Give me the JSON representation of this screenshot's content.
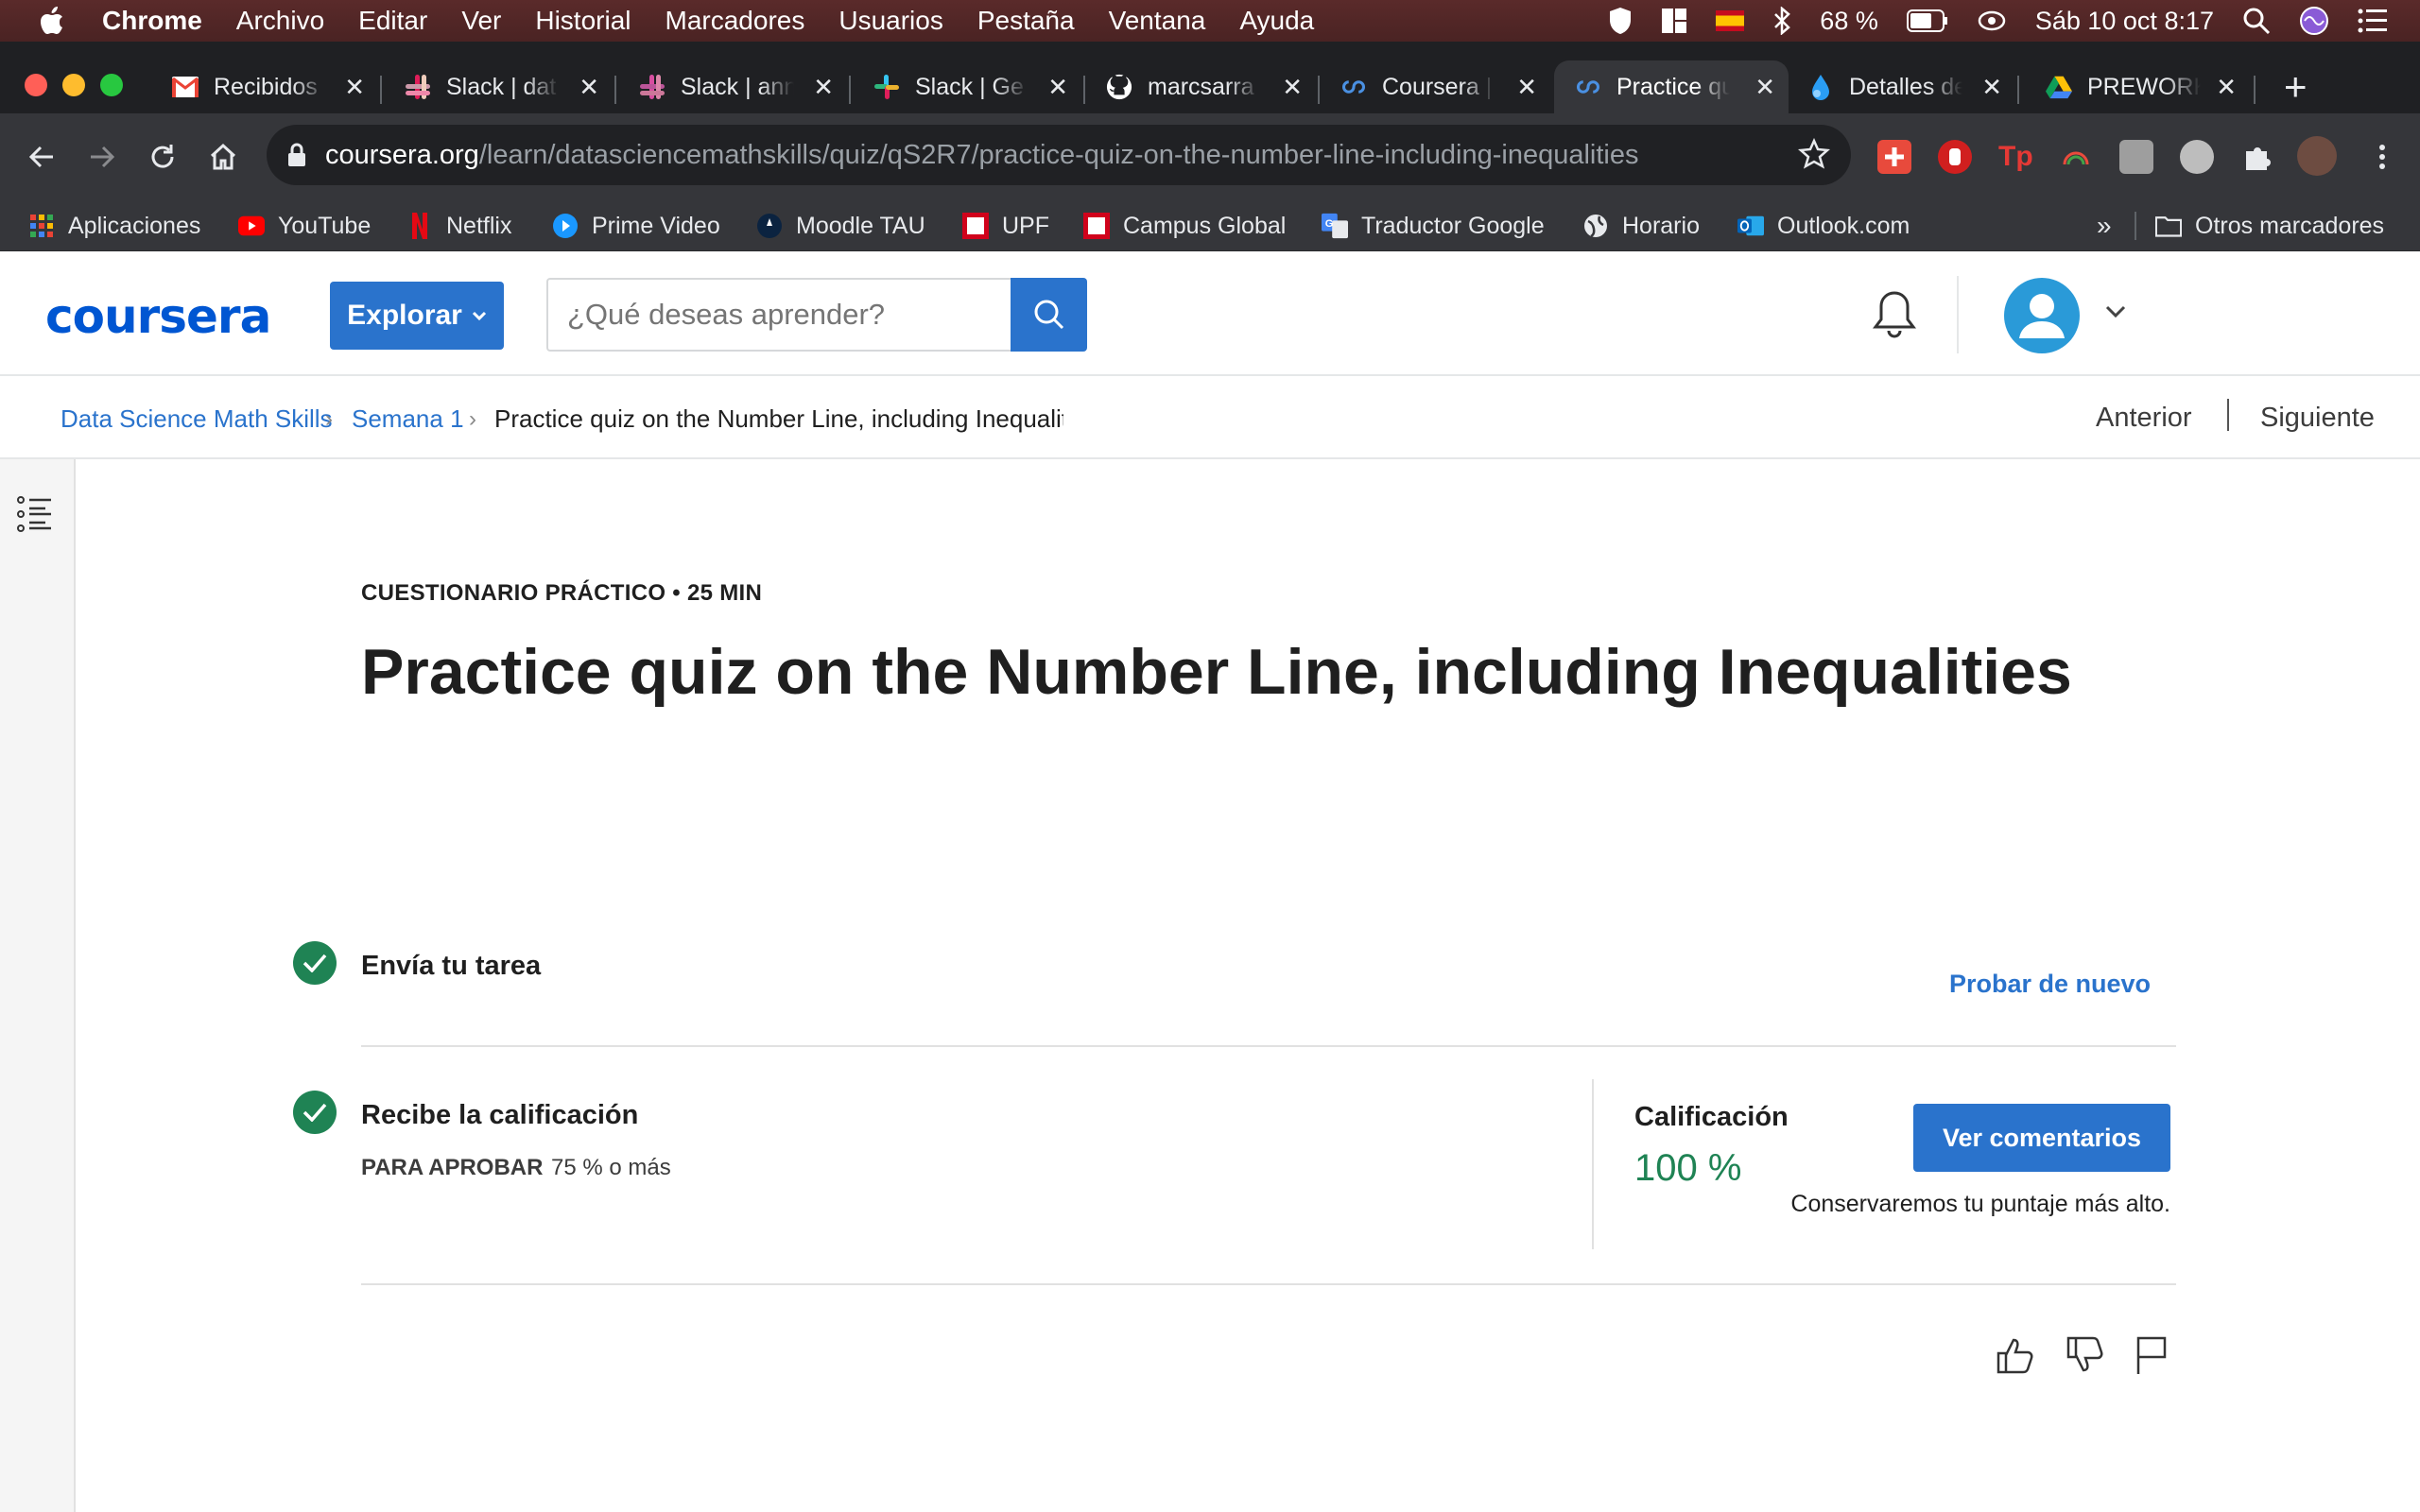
{
  "menubar": {
    "app": "Chrome",
    "items": [
      "Archivo",
      "Editar",
      "Ver",
      "Historial",
      "Marcadores",
      "Usuarios",
      "Pestaña",
      "Ventana",
      "Ayuda"
    ],
    "battery": "68 %",
    "datetime": "Sáb 10 oct  8:17"
  },
  "tabs": [
    {
      "title": "Recibidos",
      "icon": "gmail-icon"
    },
    {
      "title": "Slack | dat",
      "icon": "slack-icon"
    },
    {
      "title": "Slack | ann",
      "icon": "slack-icon"
    },
    {
      "title": "Slack | Ge",
      "icon": "slack-icon"
    },
    {
      "title": "marcsarra",
      "icon": "github-icon"
    },
    {
      "title": "Coursera |",
      "icon": "coursera-icon"
    },
    {
      "title": "Practice qu",
      "icon": "coursera-icon",
      "active": true
    },
    {
      "title": "Detalles de",
      "icon": "drop-icon"
    },
    {
      "title": "PREWORK",
      "icon": "google-drive-icon"
    }
  ],
  "address": {
    "host": "coursera.org",
    "path": "/learn/datasciencemathskills/quiz/qS2R7/practice-quiz-on-the-number-line-including-inequalities"
  },
  "bookmarks": [
    {
      "label": "Aplicaciones",
      "icon": "apps-grid-icon"
    },
    {
      "label": "YouTube",
      "icon": "youtube-icon"
    },
    {
      "label": "Netflix",
      "icon": "netflix-icon"
    },
    {
      "label": "Prime Video",
      "icon": "prime-video-icon"
    },
    {
      "label": "Moodle TAU",
      "icon": "moodle-icon"
    },
    {
      "label": "UPF",
      "icon": "upf-icon"
    },
    {
      "label": "Campus Global",
      "icon": "campus-global-icon"
    },
    {
      "label": "Traductor Google",
      "icon": "google-translate-icon"
    },
    {
      "label": "Horario",
      "icon": "globe-icon"
    },
    {
      "label": "Outlook.com",
      "icon": "outlook-icon"
    }
  ],
  "bookmarks_more": "»",
  "bookmarks_other": "Otros marcadores",
  "coursera": {
    "logo": "coursera",
    "explore_label": "Explorar",
    "search_placeholder": "¿Qué deseas aprender?"
  },
  "breadcrumb": {
    "course": "Data Science Math Skills",
    "week": "Semana 1",
    "current": "Practice quiz on the Number Line, including Inequalities",
    "prev": "Anterior",
    "next": "Siguiente"
  },
  "quiz": {
    "eyebrow": "CUESTIONARIO PRÁCTICO • 25 MIN",
    "title": "Practice quiz on the Number Line, including Inequalities",
    "step1_label": "Envía tu tarea",
    "retry_label": "Probar de nuevo",
    "step2_label": "Recibe la calificación",
    "pass_label": "PARA APROBAR",
    "pass_value": "75 % o más",
    "grade_label": "Calificación",
    "grade_value": "100 %",
    "feedback_button": "Ver comentarios",
    "keep_note": "Conservaremos tu puntaje más alto."
  },
  "colors": {
    "brand_blue": "#2a73cc",
    "success_green": "#1f8354",
    "menubar_bg": "#4a2323"
  }
}
